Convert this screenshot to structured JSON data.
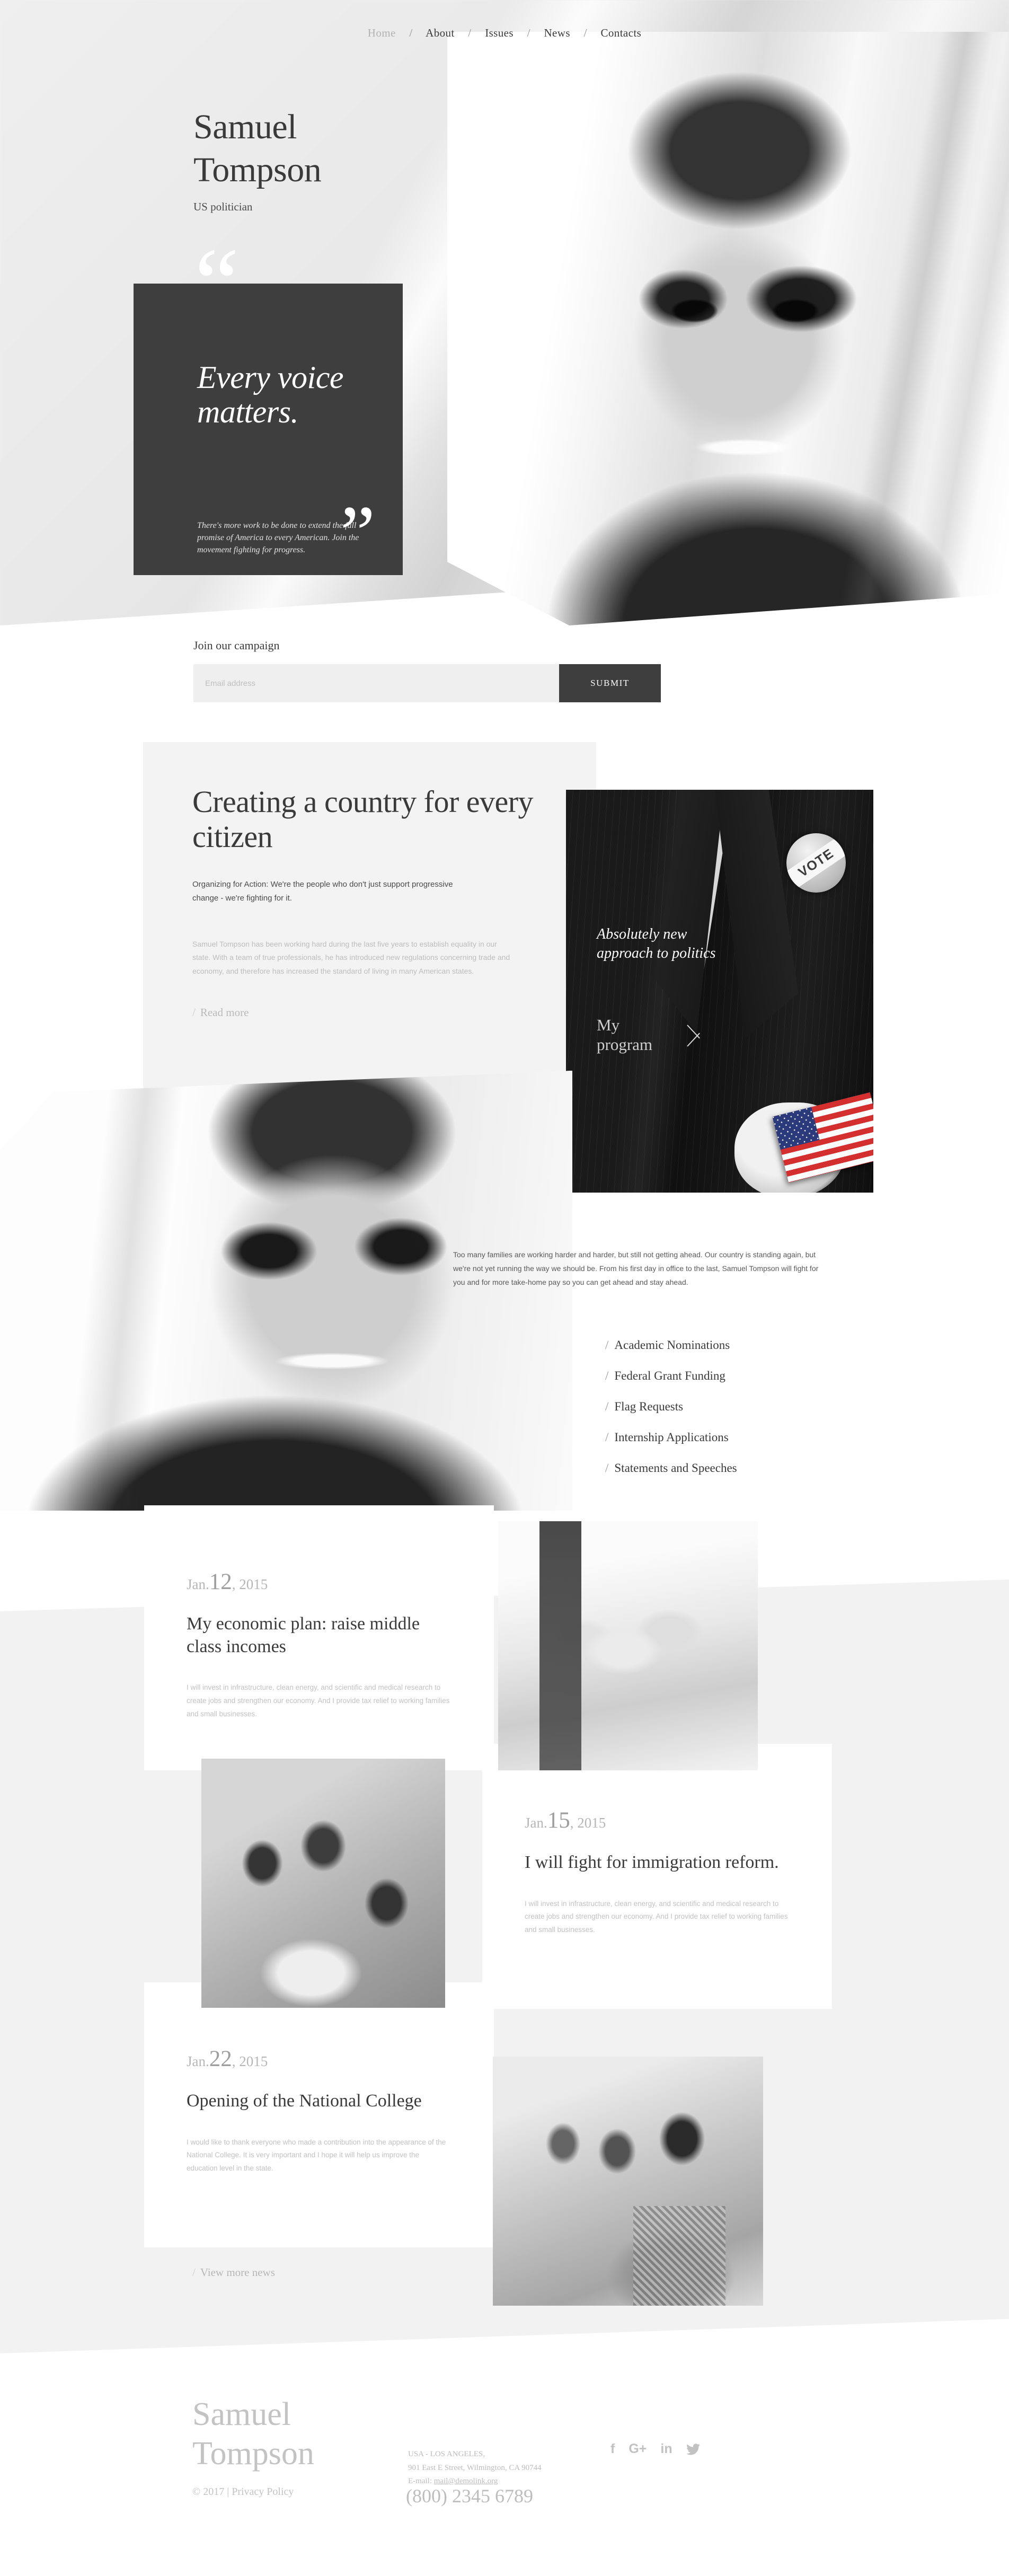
{
  "nav": {
    "items": [
      {
        "label": "Home",
        "active": true
      },
      {
        "label": "About",
        "active": false
      },
      {
        "label": "Issues",
        "active": false
      },
      {
        "label": "News",
        "active": false
      },
      {
        "label": "Contacts",
        "active": false
      }
    ],
    "separator": "/"
  },
  "hero": {
    "title_line1": "Samuel",
    "title_line2": "Tompson",
    "subtitle": "US politician",
    "quote": {
      "open_mark": "“",
      "close_mark": "”",
      "text": "Every voice matters.",
      "description": "There's more work to be done to extend the full promise of America to every American. Join the movement fighting for progress."
    }
  },
  "subscribe": {
    "heading": "Join our campaign",
    "placeholder": "Email address",
    "value": "",
    "button_label": "SUBMIT"
  },
  "about": {
    "heading": "Creating a country for every citizen",
    "lead": "Organizing for Action: We're the people who don't just support progressive change - we're fighting for it.",
    "body": "Samuel Tompson has been working hard during the last five years to establish equality in our state. With a team of true professionals, he has introduced new regulations concerning trade and economy, and therefore has increased the standard of living in many American states.",
    "read_more": "Read more",
    "slash": "/"
  },
  "program": {
    "tagline": "Absolutely new approach to politics",
    "link_label": "My program",
    "badge_text": "VOTE"
  },
  "issues": {
    "paragraph": "Too many families are working harder and harder, but still not getting ahead. Our country is standing again, but we're not yet running the way we should be. From his first day in office to the last, Samuel Tompson will fight for you and for more take-home pay so you can get ahead and stay ahead.",
    "slash": "/",
    "links": [
      "Academic Nominations",
      "Federal Grant Funding",
      "Flag Requests",
      "Internship Applications",
      "Statements and Speeches"
    ]
  },
  "news": {
    "view_more": "View more news",
    "slash": "/",
    "cards": [
      {
        "month": "Jan.",
        "day": "12",
        "year": ", 2015",
        "title": "My economic plan: raise middle class incomes",
        "body": "I will invest in infrastructure, clean energy, and scientific and medical research to create jobs and strengthen our economy. And I provide tax relief to working families and small businesses.",
        "image": "handshake-photo"
      },
      {
        "month": "Jan.",
        "day": "15",
        "year": ", 2015",
        "title": "I will fight for immigration reform.",
        "body": "I will invest in infrastructure, clean energy, and scientific and medical research to create jobs and strengthen our economy. And I provide tax relief to working families and small businesses.",
        "image": "children-photo"
      },
      {
        "month": "Jan.",
        "day": "22",
        "year": ", 2015",
        "title": "Opening of the National College",
        "body": "I would like to thank everyone who made a contribution into the appearance of the National College. It is very important and I hope it will help us improve the education level in the state.",
        "image": "students-photo"
      }
    ]
  },
  "footer": {
    "name_line1": "Samuel",
    "name_line2": "Tompson",
    "copyright": "© 2017 | ",
    "privacy_label": "Privacy Policy",
    "address_line1": "USA - LOS ANGELES,",
    "address_line2": "901 East E Street, Wilmington, CA 90744",
    "email_label": "E-mail:",
    "email": "mail@demolink.org",
    "phone": "(800) 2345 6789",
    "socials": [
      {
        "name": "facebook",
        "glyph": "f"
      },
      {
        "name": "google-plus",
        "glyph": "G+"
      },
      {
        "name": "linkedin",
        "glyph": "in"
      },
      {
        "name": "twitter",
        "glyph": ""
      }
    ]
  },
  "colors": {
    "dark": "#3e3e3e",
    "muted": "#bdbdbd",
    "panel": "#f3f3f3"
  }
}
